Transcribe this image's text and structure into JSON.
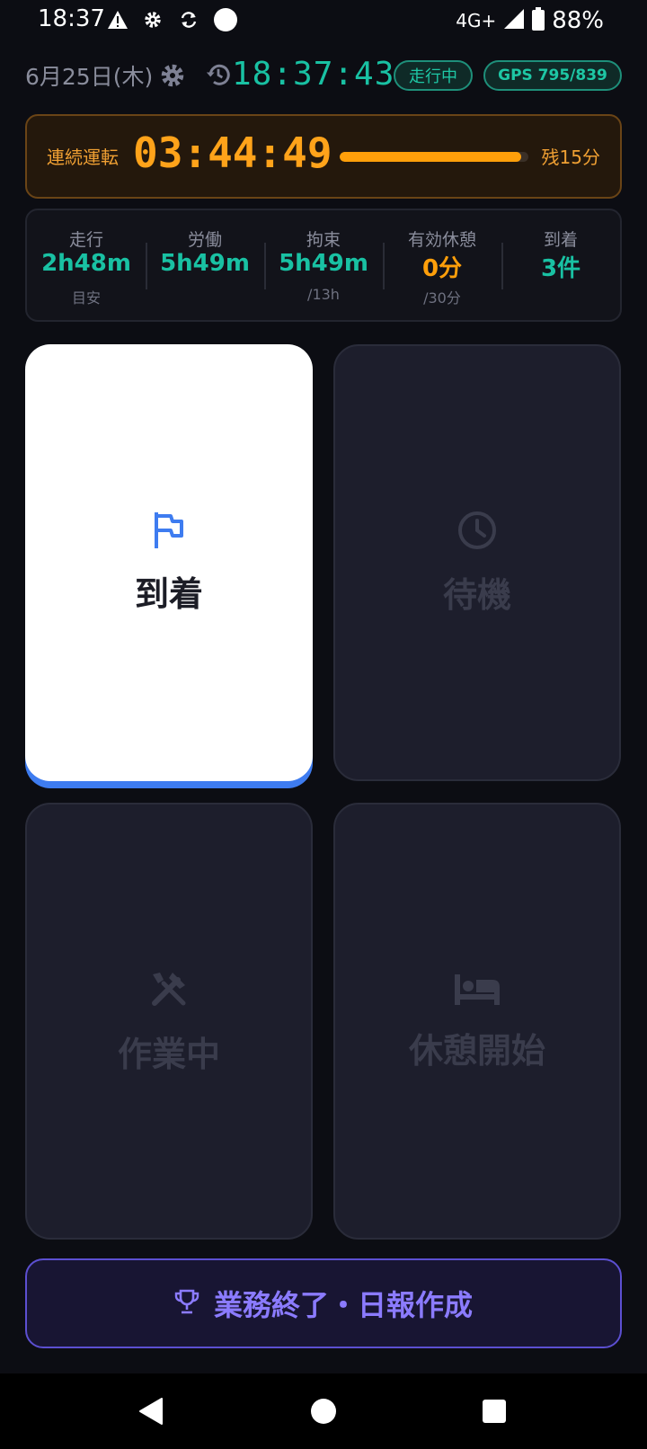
{
  "status_bar": {
    "time": "18:37",
    "network": "4G+",
    "battery": "88%",
    "icons": [
      "warning-icon",
      "gear-icon",
      "sync-icon",
      "circle-icon",
      "signal-icon",
      "battery-icon"
    ]
  },
  "header": {
    "date": "6月25日(木)",
    "clock": "18:37:43",
    "status_pill": "走行中",
    "gps_pill": "GPS 795/839",
    "accent": "#19c1a3"
  },
  "continuous_drive": {
    "label": "連続運転",
    "elapsed": "03:44:49",
    "progress_fraction": 0.96,
    "remaining": "残15分",
    "color": "#ff9f0a"
  },
  "stats": [
    {
      "label": "走行",
      "value": "2h48m",
      "sub": "目安",
      "color": "teal"
    },
    {
      "label": "労働",
      "value": "5h49m",
      "sub": "",
      "color": "teal"
    },
    {
      "label": "拘束",
      "value": "5h49m",
      "sub": "/13h",
      "color": "teal"
    },
    {
      "label": "有効休憩",
      "value": "0分",
      "sub": "/30分",
      "color": "orange"
    },
    {
      "label": "到着",
      "value": "3件",
      "sub": "",
      "color": "teal"
    }
  ],
  "actions": [
    {
      "label": "到着",
      "icon": "flag-icon",
      "active": true
    },
    {
      "label": "待機",
      "icon": "clock-icon",
      "active": false
    },
    {
      "label": "作業中",
      "icon": "tools-icon",
      "active": false
    },
    {
      "label": "休憩開始",
      "icon": "bed-icon",
      "active": false
    }
  ],
  "end_button": {
    "label": "業務終了・日報作成",
    "icon": "trophy-icon",
    "color": "#8b7bff"
  },
  "nav": {
    "icons": [
      "back-icon",
      "home-icon",
      "recents-icon"
    ]
  }
}
